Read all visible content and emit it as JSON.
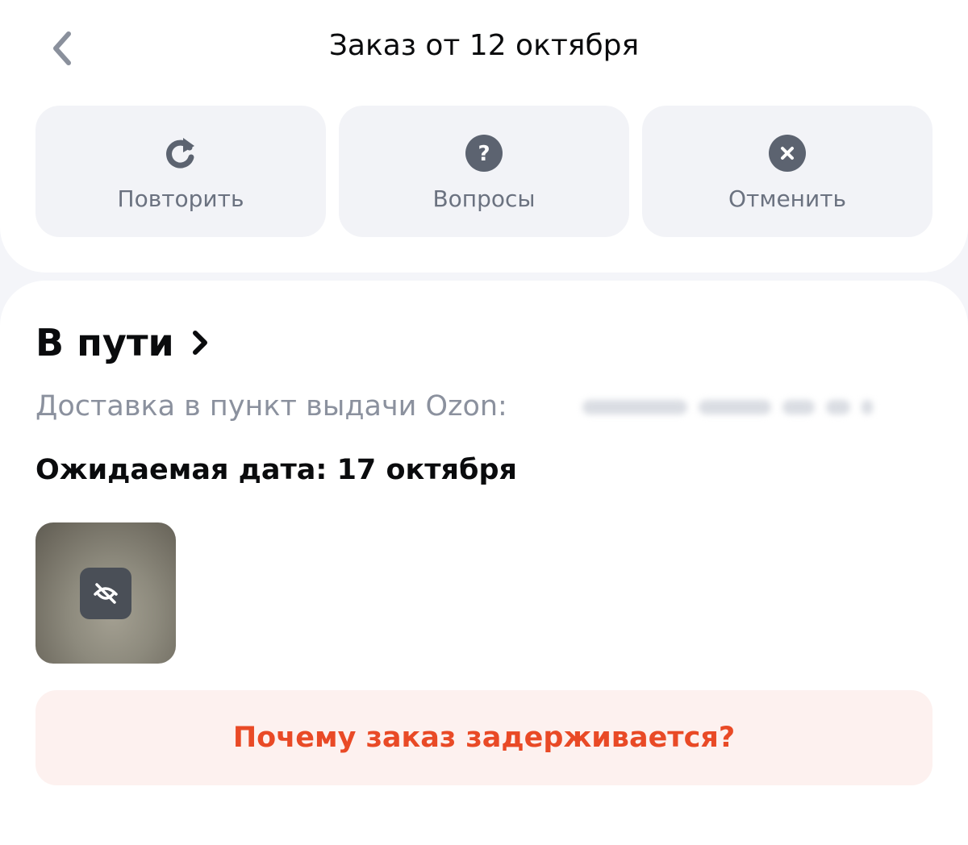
{
  "header": {
    "title": "Заказ от 12 октября",
    "back_icon": "chevron-left-icon"
  },
  "actions": [
    {
      "label": "Повторить",
      "icon": "repeat-icon"
    },
    {
      "label": "Вопросы",
      "icon": "question-icon"
    },
    {
      "label": "Отменить",
      "icon": "cancel-icon"
    }
  ],
  "order": {
    "status": "В пути",
    "delivery_text": "Доставка в пункт выдачи Ozon:",
    "expected_date": "Ожидаемая дата: 17 октября",
    "thumbnail_icon": "hidden-eye-icon"
  },
  "delay_button": {
    "label": "Почему заказ задерживается?"
  },
  "colors": {
    "accent_red": "#e94a26",
    "icon_gray": "#5c6370",
    "button_bg": "#f2f3f7",
    "delay_bg": "#fdf1ef"
  }
}
